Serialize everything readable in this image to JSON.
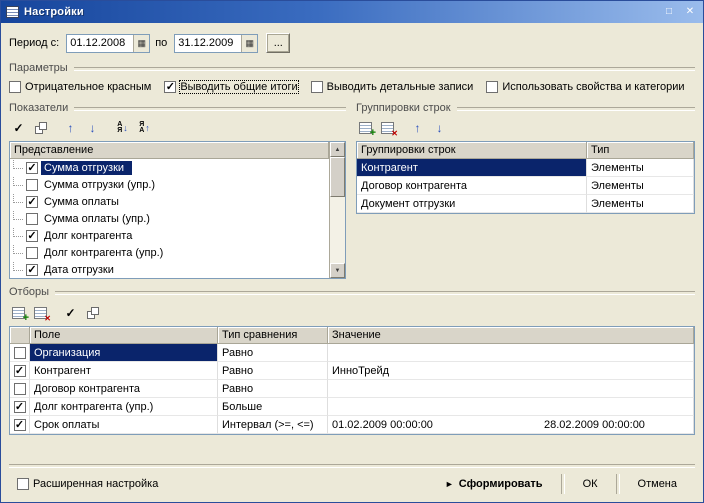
{
  "window": {
    "title": "Настройки"
  },
  "titlebar_buttons": {
    "maximize": "□",
    "close": "✕"
  },
  "period": {
    "from_label": "Период с:",
    "from_value": "01.12.2008",
    "to_label": "по",
    "to_value": "31.12.2009",
    "more_label": "..."
  },
  "params": {
    "label": "Параметры",
    "checkboxes": [
      {
        "label": "Отрицательное красным",
        "checked": false
      },
      {
        "label": "Выводить общие итоги",
        "checked": true,
        "focused": true
      },
      {
        "label": "Выводить детальные записи",
        "checked": false
      },
      {
        "label": "Использовать свойства и категории",
        "checked": false
      }
    ]
  },
  "indicators": {
    "label": "Показатели",
    "header": "Представление",
    "items": [
      {
        "label": "Сумма отгрузки",
        "checked": true,
        "selected": true
      },
      {
        "label": "Сумма отгрузки (упр.)",
        "checked": false
      },
      {
        "label": "Сумма оплаты",
        "checked": true
      },
      {
        "label": "Сумма оплаты (упр.)",
        "checked": false
      },
      {
        "label": "Долг контрагента",
        "checked": true
      },
      {
        "label": "Долг контрагента (упр.)",
        "checked": false
      },
      {
        "label": "Дата отгрузки",
        "checked": true
      }
    ]
  },
  "groupings": {
    "label": "Группировки строк",
    "columns": [
      "Группировки строк",
      "Тип"
    ],
    "rows": [
      {
        "name": "Контрагент",
        "type": "Элементы",
        "selected": true
      },
      {
        "name": "Договор контрагента",
        "type": "Элементы"
      },
      {
        "name": "Документ отгрузки",
        "type": "Элементы"
      }
    ]
  },
  "filters": {
    "label": "Отборы",
    "columns": [
      "Поле",
      "Тип сравнения",
      "Значение"
    ],
    "rows": [
      {
        "checked": false,
        "field": "Организация",
        "comparison": "Равно",
        "value": "",
        "value2": "",
        "selected": true
      },
      {
        "checked": true,
        "field": "Контрагент",
        "comparison": "Равно",
        "value": "ИнноТрейд",
        "value2": ""
      },
      {
        "checked": false,
        "field": "Договор контрагента",
        "comparison": "Равно",
        "value": "",
        "value2": ""
      },
      {
        "checked": true,
        "field": "Долг контрагента (упр.)",
        "comparison": "Больше",
        "value": "",
        "value2": ""
      },
      {
        "checked": true,
        "field": "Срок оплаты",
        "comparison": "Интервал (>=, <=)",
        "value": "01.02.2009 00:00:00",
        "value2": "28.02.2009 00:00:00"
      }
    ]
  },
  "footer": {
    "advanced_label": "Расширенная настройка",
    "advanced_checked": false,
    "generate_label": "Сформировать",
    "ok_label": "ОК",
    "cancel_label": "Отмена"
  },
  "icons": {
    "calendar": "▦",
    "check_all": "✓",
    "move_up": "↑",
    "move_down": "↓",
    "sort_letter_a": "А",
    "sort_letter_z": "Я",
    "scroll_up": "▲",
    "scroll_down": "▼",
    "play": "►"
  },
  "colors": {
    "titlebar_start": "#16459c",
    "titlebar_end": "#9abcec",
    "selection": "#0a246b",
    "selection_text": "#ffffff",
    "dialog_bg": "#ece9d8"
  }
}
